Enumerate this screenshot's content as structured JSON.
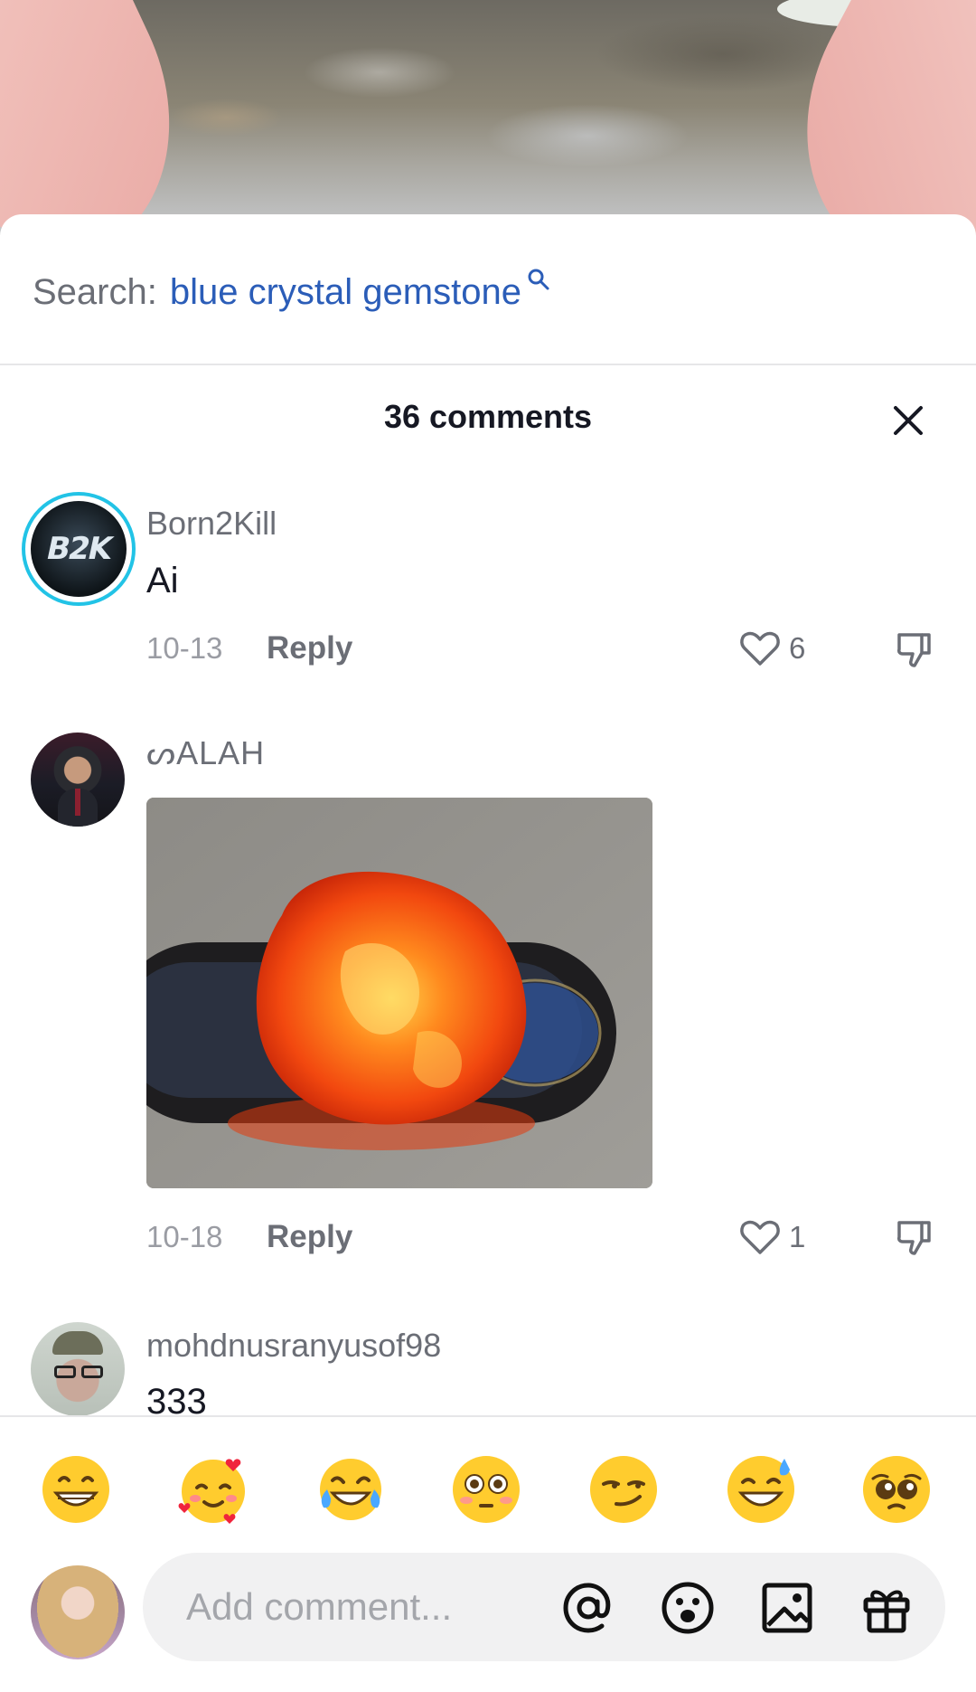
{
  "search": {
    "prefix": "Search:",
    "term": "blue crystal gemstone"
  },
  "comments_header": {
    "title": "36 comments"
  },
  "comments": [
    {
      "username": "Born2Kill",
      "avatar_text": "B2K",
      "text": "Ai",
      "date": "10-13",
      "reply_label": "Reply",
      "likes": "6"
    },
    {
      "username": "ᔕALAH",
      "text": "",
      "date": "10-18",
      "reply_label": "Reply",
      "likes": "1"
    },
    {
      "username": "mohdnusranyusof98",
      "text": "333"
    }
  ],
  "emoji_bar": {
    "emojis": [
      "😁",
      "🥰",
      "😂",
      "😳",
      "😏",
      "😅",
      "🥺"
    ]
  },
  "composer": {
    "placeholder": "Add comment..."
  },
  "colors": {
    "search_term": "#2b5db8",
    "story_ring": "#22c3e6"
  }
}
